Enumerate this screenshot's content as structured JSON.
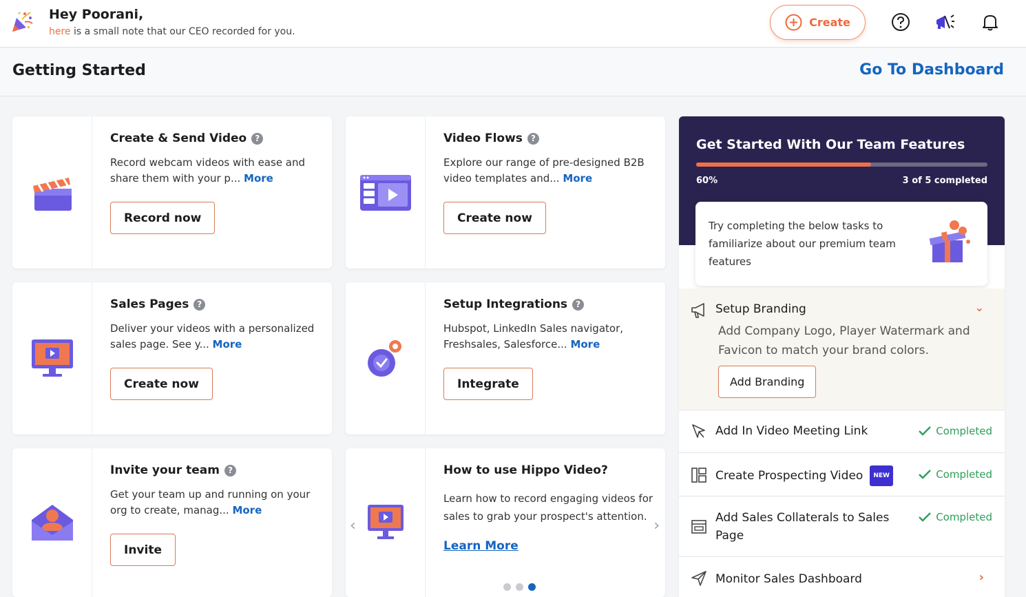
{
  "header": {
    "greeting": "Hey Poorani,",
    "note_link": "here",
    "note_text": " is a small note that our CEO recorded for you.",
    "create_label": "Create"
  },
  "subheader": {
    "title": "Getting Started",
    "dashboard_link": "Go To Dashboard"
  },
  "cards": [
    {
      "title": "Create & Send Video",
      "desc": "Record webcam videos with ease and share them with your p... ",
      "more": "More",
      "button": "Record now"
    },
    {
      "title": "Video Flows",
      "desc": "Explore our range of pre-designed B2B video templates and... ",
      "more": "More",
      "button": "Create now"
    },
    {
      "title": "Sales Pages",
      "desc": "Deliver your videos with a personalized sales page. See y... ",
      "more": "More",
      "button": "Create now"
    },
    {
      "title": "Setup Integrations",
      "desc": "Hubspot, LinkedIn Sales navigator, Freshsales, Salesforce... ",
      "more": "More",
      "button": "Integrate"
    },
    {
      "title": "Invite your team",
      "desc": "Get your team up and running on your org to create, manag... ",
      "more": "More",
      "button": "Invite"
    }
  ],
  "howto": {
    "title": "How to use Hippo Video?",
    "desc": "Learn how to record engaging videos for sales to grab your prospect's attention.",
    "link": "Learn More",
    "slide_count": 3,
    "active_slide": 3
  },
  "team_panel": {
    "title": "Get Started With Our Team Features",
    "progress_fraction": 0.6,
    "progress_label": "60%",
    "completed_label": "3 of 5 completed",
    "tip": "Try completing the below tasks to familiarize about our premium team features",
    "branding": {
      "title": "Setup Branding",
      "desc": "Add Company Logo, Player Watermark and Favicon to match your brand colors.",
      "button": "Add Branding"
    },
    "tasks": [
      {
        "label": "Add In Video Meeting Link",
        "status": "Completed"
      },
      {
        "label": "Create Prospecting Video",
        "badge": "NEW",
        "status": "Completed"
      },
      {
        "label": "Add Sales Collaterals to Sales Page",
        "status": "Completed"
      },
      {
        "label": "Monitor Sales Dashboard"
      }
    ]
  },
  "colors": {
    "accent_orange": "#ee6a3c",
    "link_blue": "#1565c0",
    "panel_dark": "#2a2350",
    "success_green": "#2e9e5b"
  }
}
